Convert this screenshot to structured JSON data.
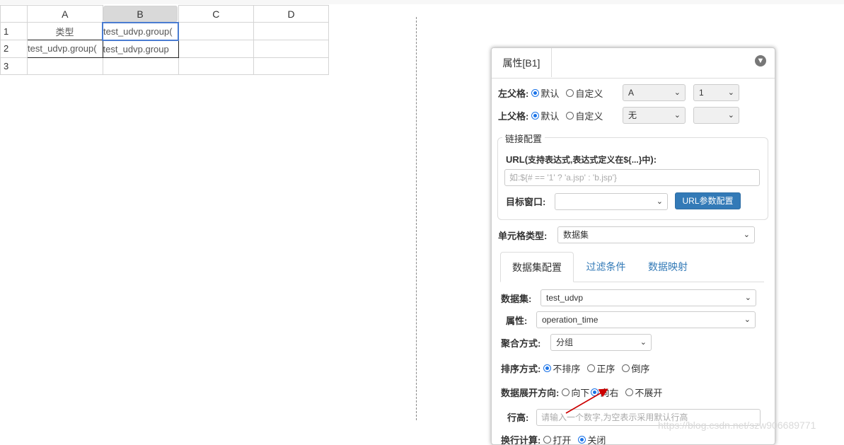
{
  "sheet": {
    "columns": [
      "A",
      "B",
      "C",
      "D"
    ],
    "rows": [
      "1",
      "2",
      "3"
    ],
    "cells": {
      "A1": "类型",
      "B1": "test_udvp.group(",
      "A2": "test_udvp.group(",
      "B2": "test_udvp.group"
    }
  },
  "panel": {
    "tab": "属性[B1]",
    "left_parent": {
      "label": "左父格:",
      "opt_default": "默认",
      "opt_custom": "自定义",
      "col": "A",
      "row": "1"
    },
    "top_parent": {
      "label": "上父格:",
      "opt_default": "默认",
      "opt_custom": "自定义",
      "col": "无",
      "row": ""
    },
    "link": {
      "legend": "链接配置",
      "url_label": "URL(",
      "url_hint": "支持表达式,表达式定义在${...}中",
      "url_label_end": "):",
      "url_placeholder": "如:${# == '1' ? 'a.jsp' : 'b.jsp'}",
      "target_label": "目标窗口:",
      "target_value": "",
      "param_button": "URL参数配置"
    },
    "cell_type": {
      "label": "单元格类型:",
      "value": "数据集"
    },
    "subtabs": [
      "数据集配置",
      "过滤条件",
      "数据映射"
    ],
    "dataset": {
      "label": "数据集:",
      "value": "test_udvp"
    },
    "property": {
      "label": "属性:",
      "value": "operation_time"
    },
    "aggregate": {
      "label": "聚合方式:",
      "value": "分组"
    },
    "sort": {
      "label": "排序方式:",
      "options": [
        "不排序",
        "正序",
        "倒序"
      ],
      "selected": 0
    },
    "expand": {
      "label": "数据展开方向:",
      "options": [
        "向下",
        "向右",
        "不展开"
      ],
      "selected": 1
    },
    "row_height": {
      "label": "行高:",
      "placeholder": "请输入一个数字,为空表示采用默认行高"
    },
    "wrap": {
      "label": "换行计算:",
      "options": [
        "打开",
        "关闭"
      ],
      "selected": 1
    }
  },
  "watermark": "https://blog.csdn.net/szw906689771",
  "colors": {
    "accent": "#337ab7",
    "selection": "#4a7cd1",
    "arrow": "#cc0000"
  }
}
